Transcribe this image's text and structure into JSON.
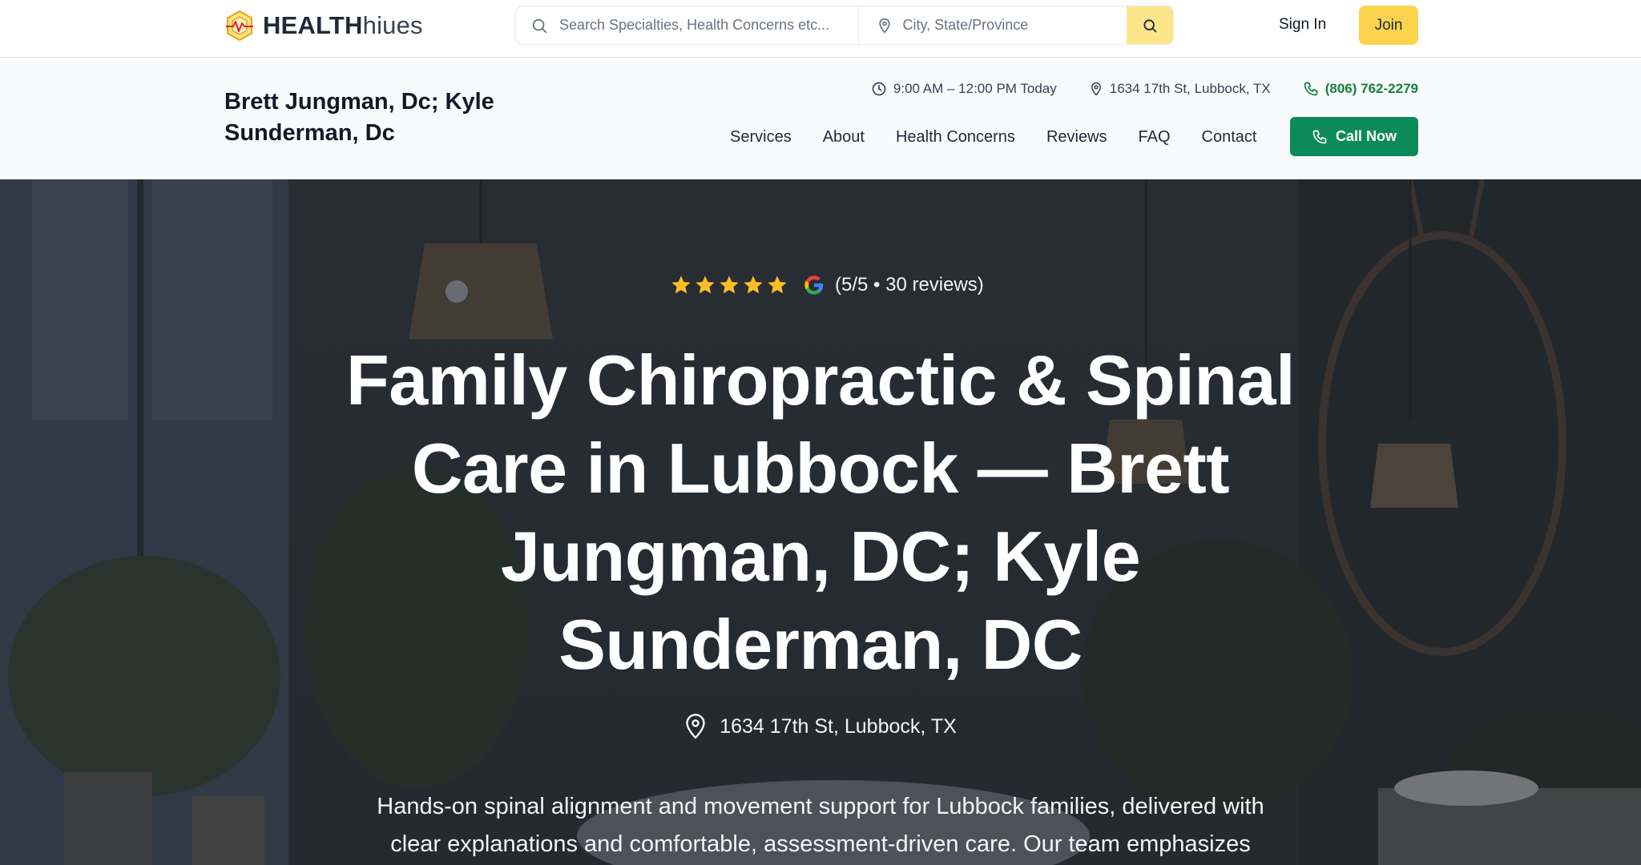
{
  "brand": {
    "name_strong": "HEALTH",
    "name_light": "hiues"
  },
  "search": {
    "specialty_placeholder": "Search Specialties, Health Concerns etc...",
    "location_placeholder": "City, State/Province",
    "button_icon": "search-icon"
  },
  "account": {
    "sign_in": "Sign In",
    "join": "Join"
  },
  "practice": {
    "name": "Brett Jungman, Dc; Kyle Sunderman, Dc",
    "hours": "9:00 AM – 12:00 PM Today",
    "address": "1634 17th St, Lubbock, TX",
    "phone": "(806) 762-2279"
  },
  "nav": {
    "items": [
      {
        "label": "Services"
      },
      {
        "label": "About"
      },
      {
        "label": "Health Concerns"
      },
      {
        "label": "Reviews"
      },
      {
        "label": "FAQ"
      },
      {
        "label": "Contact"
      }
    ],
    "call_button": "Call Now"
  },
  "hero": {
    "rating": {
      "stars": 5,
      "max": 5,
      "text": "(5/5 • 30 reviews)",
      "source_icon": "google-icon"
    },
    "title": "Family Chiropractic & Spinal Care in Lubbock — Brett Jungman, DC; Kyle Sunderman, DC",
    "address": "1634 17th St, Lubbock, TX",
    "description": "Hands-on spinal alignment and movement support for Lubbock families, delivered with clear explanations and comfortable, assessment-driven care. Our team emphasizes"
  },
  "colors": {
    "accent_yellow": "#fcd34d",
    "search_button": "#fde68a",
    "call_green": "#0c8a5a",
    "phone_green": "#15803d",
    "star_gold": "#fbbf24"
  }
}
